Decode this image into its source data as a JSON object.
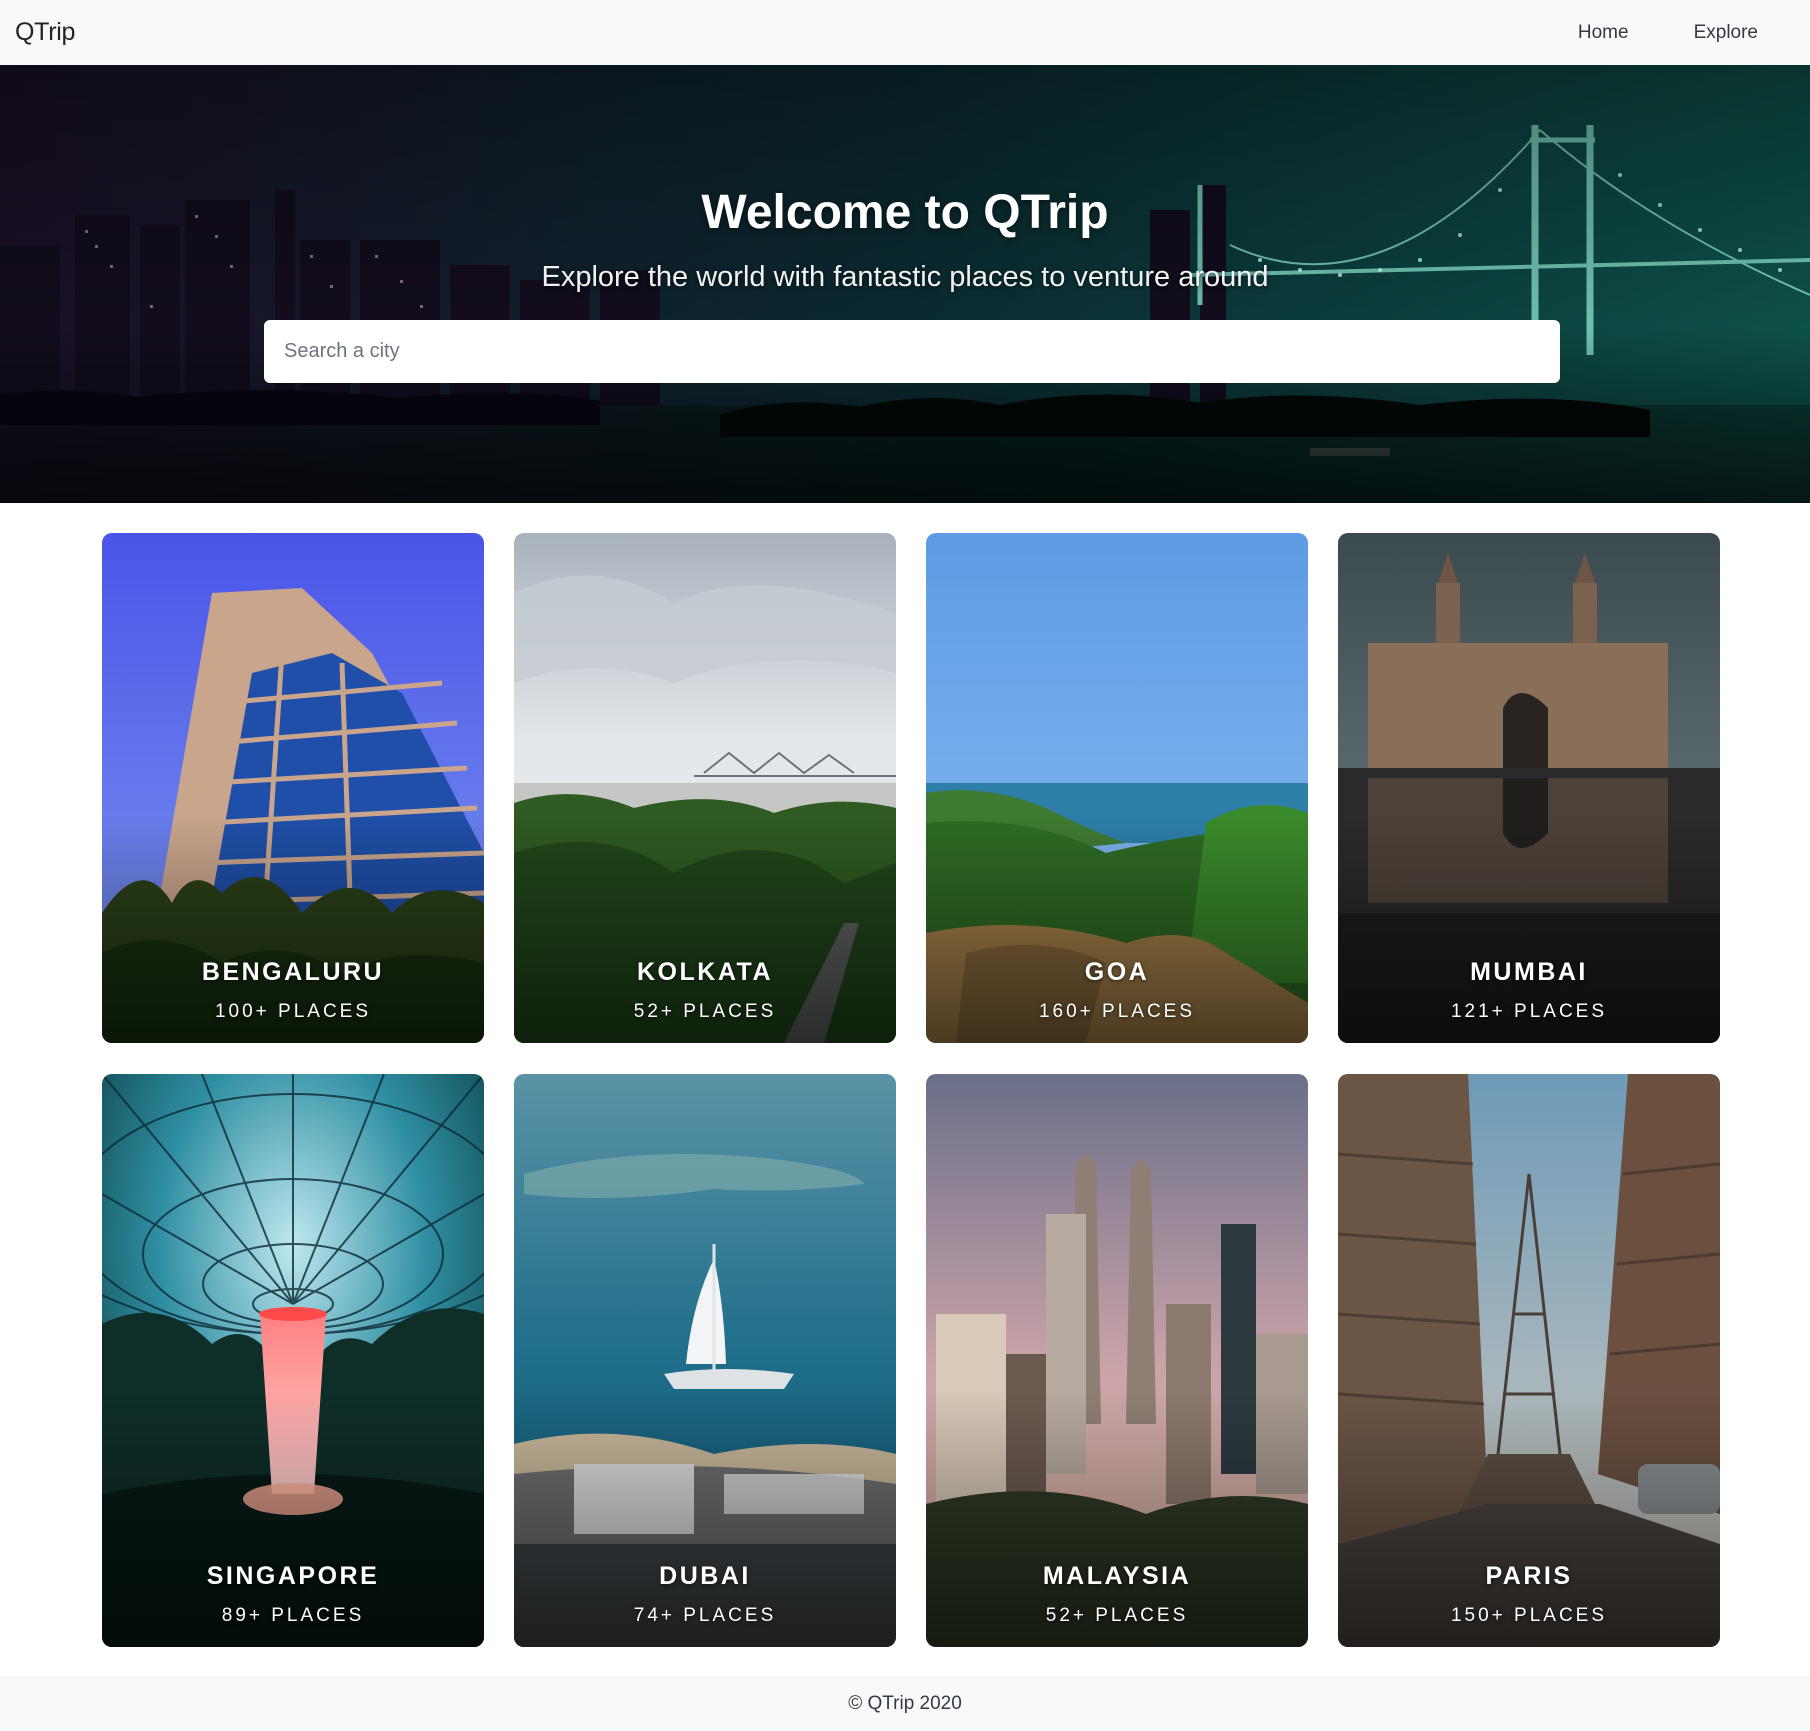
{
  "navbar": {
    "brand": "QTrip",
    "links": [
      {
        "label": "Home"
      },
      {
        "label": "Explore"
      }
    ]
  },
  "hero": {
    "title": "Welcome to QTrip",
    "subtitle": "Explore the world with fantastic places to venture around",
    "search": {
      "placeholder": "Search a city",
      "value": ""
    }
  },
  "cities": [
    {
      "name": "BENGALURU",
      "places": "100+ PLACES"
    },
    {
      "name": "KOLKATA",
      "places": "52+ PLACES"
    },
    {
      "name": "GOA",
      "places": "160+ PLACES"
    },
    {
      "name": "MUMBAI",
      "places": "121+ PLACES"
    },
    {
      "name": "SINGAPORE",
      "places": "89+ PLACES"
    },
    {
      "name": "DUBAI",
      "places": "74+ PLACES"
    },
    {
      "name": "MALAYSIA",
      "places": "52+ PLACES"
    },
    {
      "name": "PARIS",
      "places": "150+ PLACES"
    }
  ],
  "footer": {
    "text": "© QTrip 2020"
  },
  "colors": {
    "navbar_bg": "#f8f9fa",
    "hero_tint": "#0b3b3a",
    "text_white": "#ffffff"
  }
}
